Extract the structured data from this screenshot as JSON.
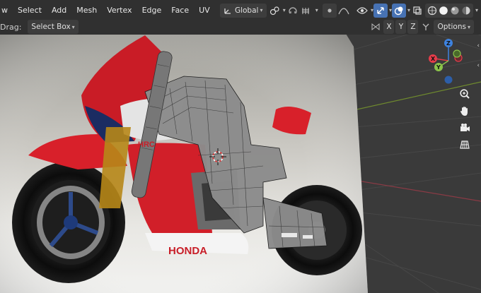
{
  "header": {
    "menu": [
      "w",
      "Select",
      "Add",
      "Mesh",
      "Vertex",
      "Edge",
      "Face",
      "UV"
    ],
    "transform_orientation": "Global"
  },
  "toolbar": {
    "drag_label": "Drag:",
    "select_mode": "Select Box",
    "mirror_axes": [
      "X",
      "Y",
      "Z"
    ],
    "options_label": "Options"
  },
  "gizmo": {
    "axes": {
      "x": "X",
      "y": "Y",
      "z": "Z"
    },
    "colors": {
      "x": "#e63c4a",
      "y": "#8bc34a",
      "z": "#3e83e0"
    }
  },
  "reference_image": {
    "brand_text": "HONDA",
    "tank_text": "HRC"
  },
  "colors": {
    "header_bg": "#303030",
    "viewport_bg": "#393939",
    "accent_blue": "#4772b3",
    "x_axis_line": "#8a3a45",
    "y_axis_line": "#6f8a2e"
  }
}
